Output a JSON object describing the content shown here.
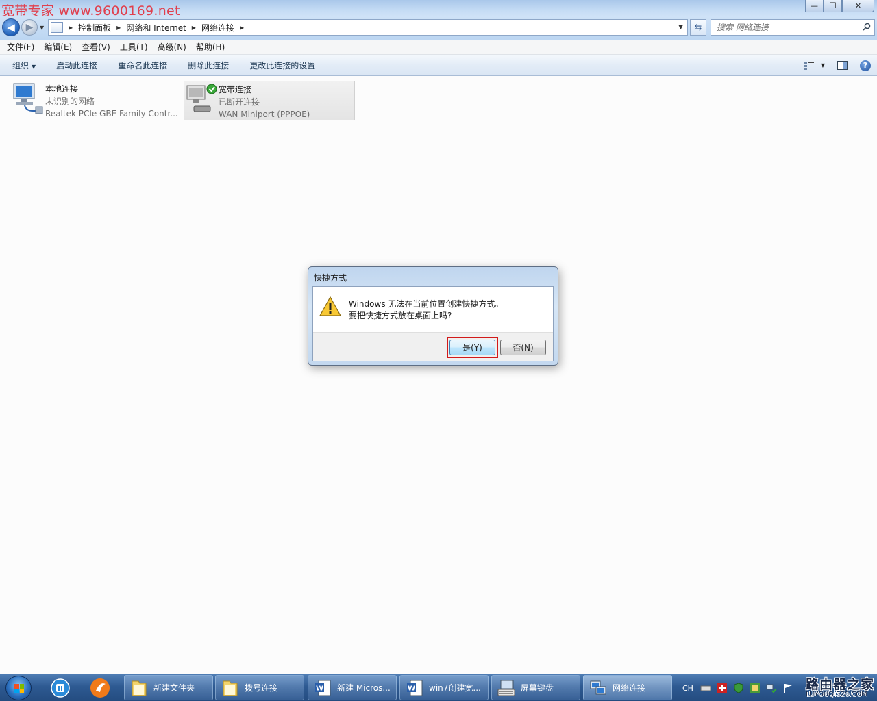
{
  "window": {
    "watermark": "宽带专家 www.9600169.net",
    "controls": {
      "minimize": "—",
      "restore": "❐",
      "close": "✕"
    }
  },
  "nav": {
    "breadcrumbs": [
      "控制面板",
      "网络和 Internet",
      "网络连接"
    ],
    "search_placeholder": "搜索 网络连接"
  },
  "menubar": {
    "items": [
      "文件(F)",
      "编辑(E)",
      "查看(V)",
      "工具(T)",
      "高级(N)",
      "帮助(H)"
    ]
  },
  "commandbar": {
    "organize": "组织",
    "commands": [
      "启动此连接",
      "重命名此连接",
      "删除此连接",
      "更改此连接的设置"
    ]
  },
  "connections": [
    {
      "name": "本地连接",
      "status": "未识别的网络",
      "device": "Realtek PCIe GBE Family Contr..."
    },
    {
      "name": "宽带连接",
      "status": "已断开连接",
      "device": "WAN Miniport (PPPOE)"
    }
  ],
  "dialog": {
    "title": "快捷方式",
    "message_line1": "Windows 无法在当前位置创建快捷方式。",
    "message_line2": "要把快捷方式放在桌面上吗?",
    "yes_label": "是(Y)",
    "no_label": "否(N)",
    "highlight_color": "#d21a1a"
  },
  "taskbar": {
    "items": [
      {
        "label": "新建文件夹",
        "icon": "folder-icon"
      },
      {
        "label": "拨号连接",
        "icon": "folder-icon"
      },
      {
        "label": "新建 Micros...",
        "icon": "word-icon"
      },
      {
        "label": "win7创建宽...",
        "icon": "word-icon"
      },
      {
        "label": "屏幕键盘",
        "icon": "keyboard-icon"
      },
      {
        "label": "网络连接",
        "icon": "network-icon"
      }
    ],
    "tray_lang": "CH",
    "brand_line1": "路由器之家",
    "brand_line2": "LUYOUQI520.COM"
  }
}
